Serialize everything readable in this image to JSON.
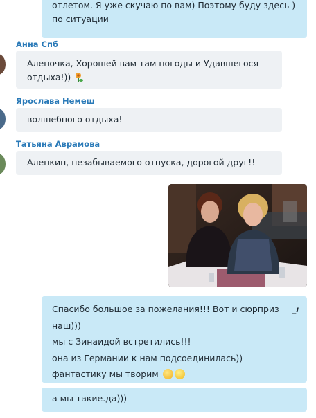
{
  "messages": {
    "top_outgoing": {
      "lines": [
        "отлетом. Я уже скучаю по вам) Поэтому буду здесь )",
        "по ситуации"
      ]
    },
    "anna": {
      "sender": "Анна Спб",
      "lines": [
        "Аленочка, Хорошей вам там погоды и Удавшегося",
        "отдыха!))"
      ]
    },
    "yaroslava": {
      "sender": "Ярослава Немеш",
      "text": "волшебного отдыха!"
    },
    "tatyana": {
      "sender": "Татьяна Аврамова",
      "text": "Аленкин, незабываемого отпуска, дорогой друг!!"
    },
    "reply": {
      "lines": [
        "Спасибо большое за пожелания!!! Вот и сюрприз",
        "наш)))",
        "мы с Зинаидой встретились!!!",
        "она из Германии к нам подсоединилась))",
        "фантастику мы творим"
      ],
      "edit_mark": "_i"
    },
    "last": {
      "text": "а мы такие.да)))"
    }
  },
  "colors": {
    "outgoing_bubble": "#c9e9f7",
    "incoming_bubble": "#eef1f4",
    "sender_name": "#2a7ab8"
  }
}
